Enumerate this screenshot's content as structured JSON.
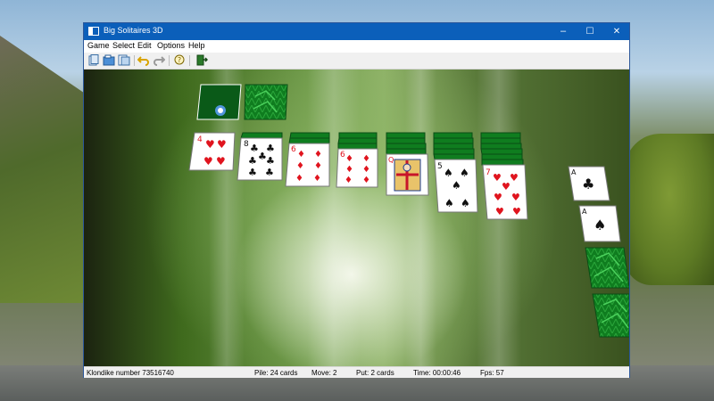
{
  "window": {
    "title": "Big Solitaires 3D",
    "controls": {
      "minimize": "–",
      "maximize": "☐",
      "close": "✕"
    }
  },
  "menu": [
    "Game",
    "Select",
    "Edit",
    "Options",
    "Help"
  ],
  "toolbar": {
    "icons": [
      "new-game-icon",
      "open-icon",
      "save-icon",
      "undo-icon",
      "redo-icon",
      "hint-icon",
      "exit-icon"
    ]
  },
  "status": {
    "game": "Klondike number 73516740",
    "pile": "Pile: 24 cards",
    "move": "Move: 2",
    "put": "Put: 2 cards",
    "time": "Time: 00:00:46",
    "fps": "Fps:  57"
  },
  "board": {
    "tableau": [
      {
        "rank": "4",
        "suit": "♥",
        "face_down": 0
      },
      {
        "rank": "8",
        "suit": "♣",
        "face_down": 1
      },
      {
        "rank": "6",
        "suit": "♦",
        "face_down": 2
      },
      {
        "rank": "6",
        "suit": "♦",
        "face_down": 3
      },
      {
        "rank": "Q",
        "suit": "♦",
        "face_down": 4
      },
      {
        "rank": "5",
        "suit": "♠",
        "face_down": 5
      },
      {
        "rank": "7",
        "suit": "♥",
        "face_down": 6
      }
    ],
    "foundations": [
      {
        "rank": "A",
        "suit": "♣"
      },
      {
        "rank": "A",
        "suit": "♠"
      },
      {
        "rank": "",
        "suit": ""
      },
      {
        "rank": "",
        "suit": ""
      }
    ],
    "colors": {
      "back": "#0f7d1f",
      "back_dark": "#0a5716",
      "red": "#e0141e",
      "black": "#111111",
      "face": "#ffffff"
    }
  }
}
